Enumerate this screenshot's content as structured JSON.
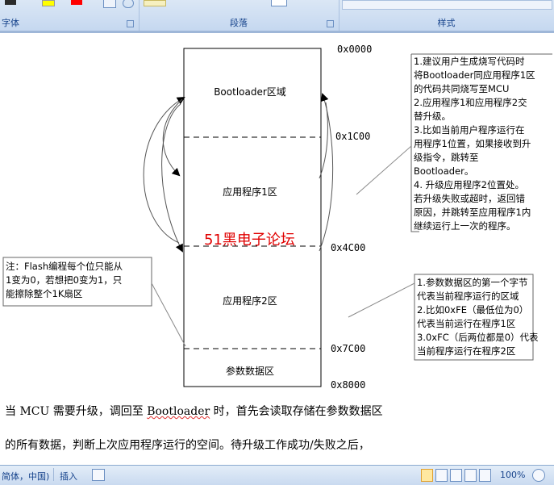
{
  "ribbon": {
    "font_group_label": "字体",
    "paragraph_group_label": "段落",
    "styles_group_label": "样式"
  },
  "diagram": {
    "regions": [
      {
        "label": "Bootloader区域"
      },
      {
        "label": "应用程序1区"
      },
      {
        "label": "应用程序2区"
      },
      {
        "label": "参数数据区"
      }
    ],
    "addresses": [
      "0x0000",
      "0x1C00",
      "0x4C00",
      "0x7C00",
      "0x8000"
    ],
    "watermark": "51黑电子论坛",
    "note_flash": [
      "注：Flash编程每个位只能从",
      "1变为0，若想把0变为1，只",
      "能擦除整个1K扇区"
    ],
    "note_upgrade": [
      "1.建议用户生成烧写代码时",
      "将Bootloader同应用程序1区",
      "的代码共同烧写至MCU",
      "2.应用程序1和应用程序2交",
      "替升级。",
      "3.比如当前用户程序运行在",
      "用程序1位置，如果接收到升",
      "级指令，跳转至",
      "Bootloader。",
      "4. 升级应用程序2位置处。",
      "若升级失败或超时，返回错",
      "原因，并跳转至应用程序1内",
      "继续运行上一次的程序。"
    ],
    "note_params": [
      "1.参数数据区的第一个字节",
      "代表当前程序运行的区域",
      "2.比如0xFE（最低位为0）",
      "代表当前运行在程序1区",
      "3.0xFC（后两位都是0）代表",
      "当前程序运行在程序2区"
    ]
  },
  "body": {
    "line1_a": "当 MCU 需要升级，调回至 ",
    "line1_b": "Bootloader",
    "line1_c": " 时，首先会读取存储在参数数据区",
    "line2": "的所有数据，判断上次应用程序运行的空间。待升级工作成功/失败之后，"
  },
  "status": {
    "language": "简体，中国)",
    "insert_mode": "插入",
    "zoom": "100%"
  }
}
